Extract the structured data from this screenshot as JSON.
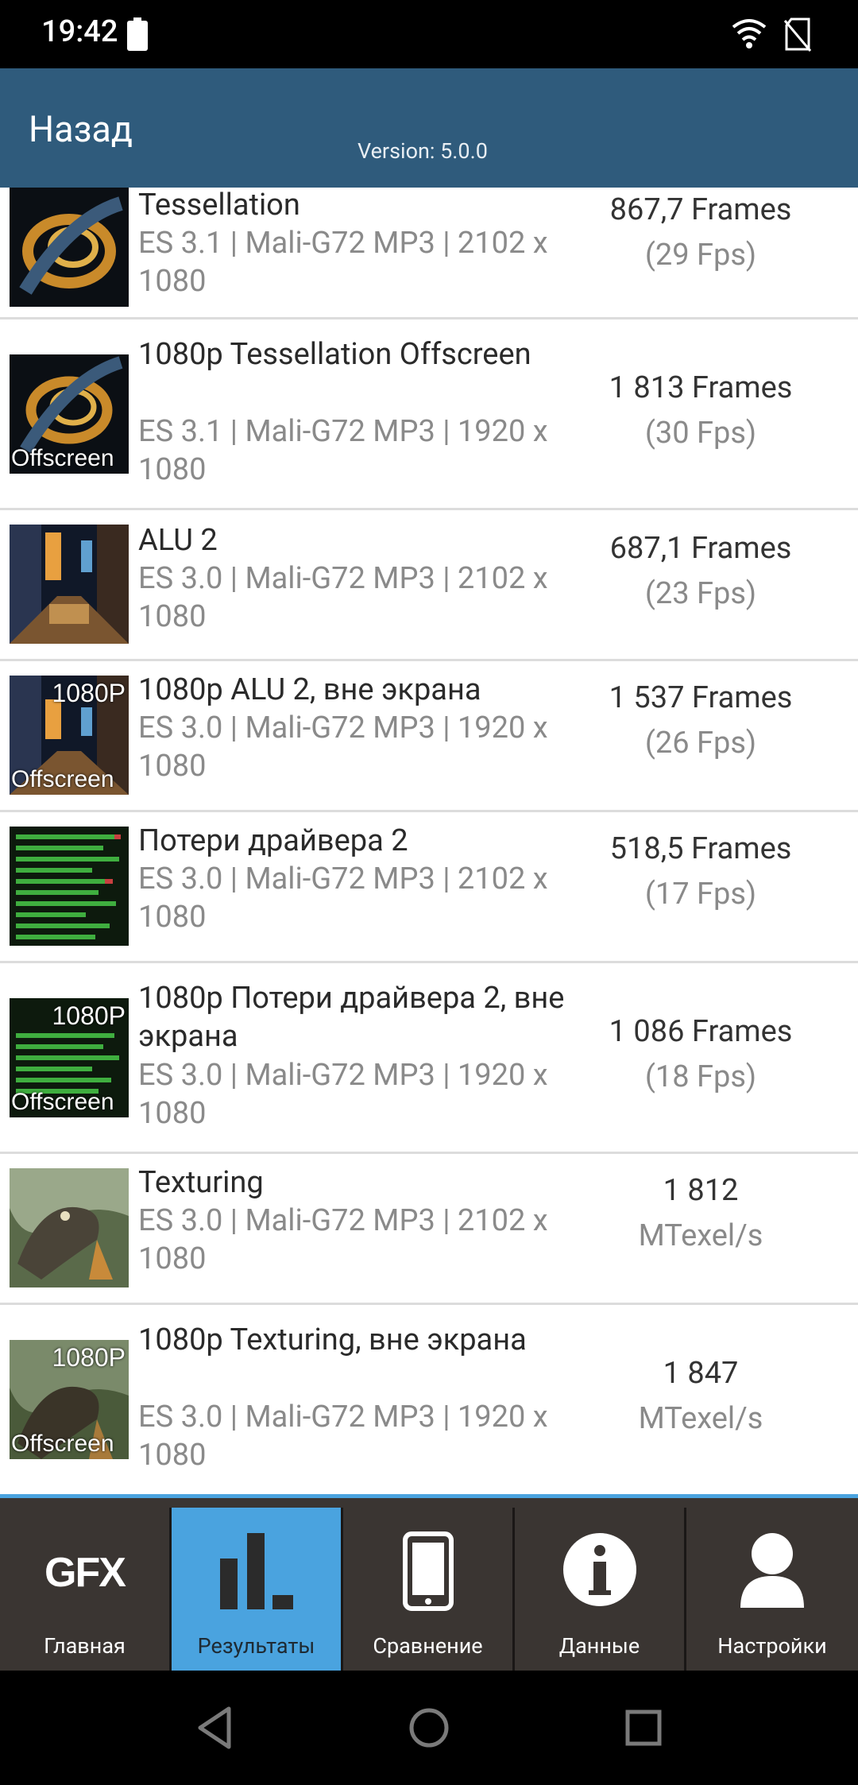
{
  "status_bar": {
    "time": "19:42"
  },
  "app_bar": {
    "back_label": "Назад",
    "version": "Version: 5.0.0"
  },
  "results": [
    {
      "name": "Tessellation",
      "meta": "ES 3.1 | Mali-G72 MP3 | 2102 x 1080",
      "score_main": "867,7 Frames",
      "score_sub": "(29 Fps)",
      "thumb": "tessellation"
    },
    {
      "name": "1080p Tessellation Offscreen",
      "meta": "ES 3.1 | Mali-G72 MP3 | 1920 x 1080",
      "score_main": "1 813 Frames",
      "score_sub": "(30 Fps)",
      "thumb": "tessellation",
      "badge_bottom": "Offscreen"
    },
    {
      "name": "ALU 2",
      "meta": "ES 3.0 | Mali-G72 MP3 | 2102 x 1080",
      "score_main": "687,1 Frames",
      "score_sub": "(23 Fps)",
      "thumb": "alu"
    },
    {
      "name": "1080p ALU 2, вне экрана",
      "meta": "ES 3.0 | Mali-G72 MP3 | 1920 x 1080",
      "score_main": "1 537 Frames",
      "score_sub": "(26 Fps)",
      "thumb": "alu",
      "badge_top": "1080P",
      "badge_bottom": "Offscreen"
    },
    {
      "name": "Потери драйвера 2",
      "meta": "ES 3.0 | Mali-G72 MP3 | 2102 x 1080",
      "score_main": "518,5 Frames",
      "score_sub": "(17 Fps)",
      "thumb": "driver"
    },
    {
      "name": "1080p Потери драйвера 2, вне экрана",
      "meta": "ES 3.0 | Mali-G72 MP3 | 1920 x 1080",
      "score_main": "1 086 Frames",
      "score_sub": "(18 Fps)",
      "thumb": "driver",
      "badge_top": "1080P",
      "badge_bottom": "Offscreen"
    },
    {
      "name": "Texturing",
      "meta": "ES 3.0 | Mali-G72 MP3 | 2102 x 1080",
      "score_main": "1 812",
      "score_sub": "MTexel/s",
      "thumb": "texturing"
    },
    {
      "name": "1080p Texturing, вне экрана",
      "meta": "ES 3.0 | Mali-G72 MP3 | 1920 x 1080",
      "score_main": "1 847",
      "score_sub": "MTexel/s",
      "thumb": "texturing",
      "badge_top": "1080P",
      "badge_bottom": "Offscreen"
    }
  ],
  "tabs": [
    {
      "label": "Главная",
      "icon": "gfx-logo-icon",
      "icon_text": "GFX"
    },
    {
      "label": "Результаты",
      "icon": "bar-chart-icon",
      "active": true
    },
    {
      "label": "Сравнение",
      "icon": "phone-icon"
    },
    {
      "label": "Данные",
      "icon": "info-icon"
    },
    {
      "label": "Настройки",
      "icon": "user-icon"
    }
  ],
  "colors": {
    "app_bar": "#2f5b7c",
    "accent": "#4aa3df",
    "tab_bar": "#3a3532"
  }
}
